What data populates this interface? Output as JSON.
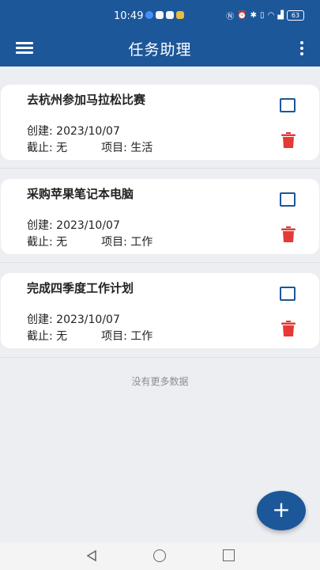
{
  "status_bar": {
    "time": "10:49",
    "battery": "63"
  },
  "app": {
    "title": "任务助理"
  },
  "tasks": [
    {
      "title": "去杭州参加马拉松比赛",
      "created_label": "创建:",
      "created": "2023/10/07",
      "deadline_label": "截止:",
      "deadline": "无",
      "project_label": "项目:",
      "project": "生活"
    },
    {
      "title": "采购苹果笔记本电脑",
      "created_label": "创建:",
      "created": "2023/10/07",
      "deadline_label": "截止:",
      "deadline": "无",
      "project_label": "项目:",
      "project": "工作"
    },
    {
      "title": "完成四季度工作计划",
      "created_label": "创建:",
      "created": "2023/10/07",
      "deadline_label": "截止:",
      "deadline": "无",
      "project_label": "项目:",
      "project": "工作"
    }
  ],
  "list_footer": "没有更多数据",
  "fab": {
    "label": "+"
  },
  "colors": {
    "primary": "#1c5799",
    "delete": "#e53935",
    "background": "#eceef1"
  }
}
